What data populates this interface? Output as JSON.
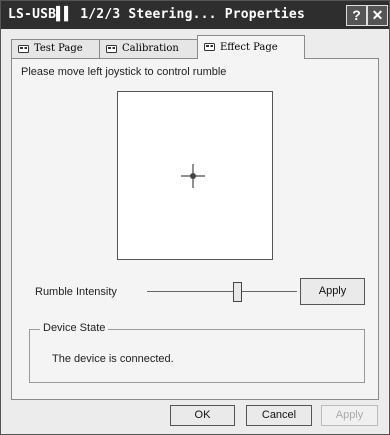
{
  "window": {
    "title": "LS-USB▌▌ 1/2/3 Steering... Properties",
    "help_glyph": "?",
    "close_glyph": "✕"
  },
  "tabs": [
    {
      "label": "Test Page",
      "icon": "gamepad-icon",
      "active": false
    },
    {
      "label": "Calibration",
      "icon": "gamepad-icon",
      "active": false
    },
    {
      "label": "Effect Page",
      "icon": "gamepad-icon",
      "active": true
    }
  ],
  "effect_page": {
    "instruction": "Please move left joystick to control rumble",
    "joystick_area_icon": "crosshair-icon",
    "rumble_label": "Rumble Intensity",
    "rumble_level": 0.6,
    "apply_label": "Apply",
    "device_state_title": "Device State",
    "device_state_text": "The device is connected."
  },
  "buttons": {
    "ok": "OK",
    "cancel": "Cancel",
    "apply": "Apply",
    "apply_disabled": true
  }
}
